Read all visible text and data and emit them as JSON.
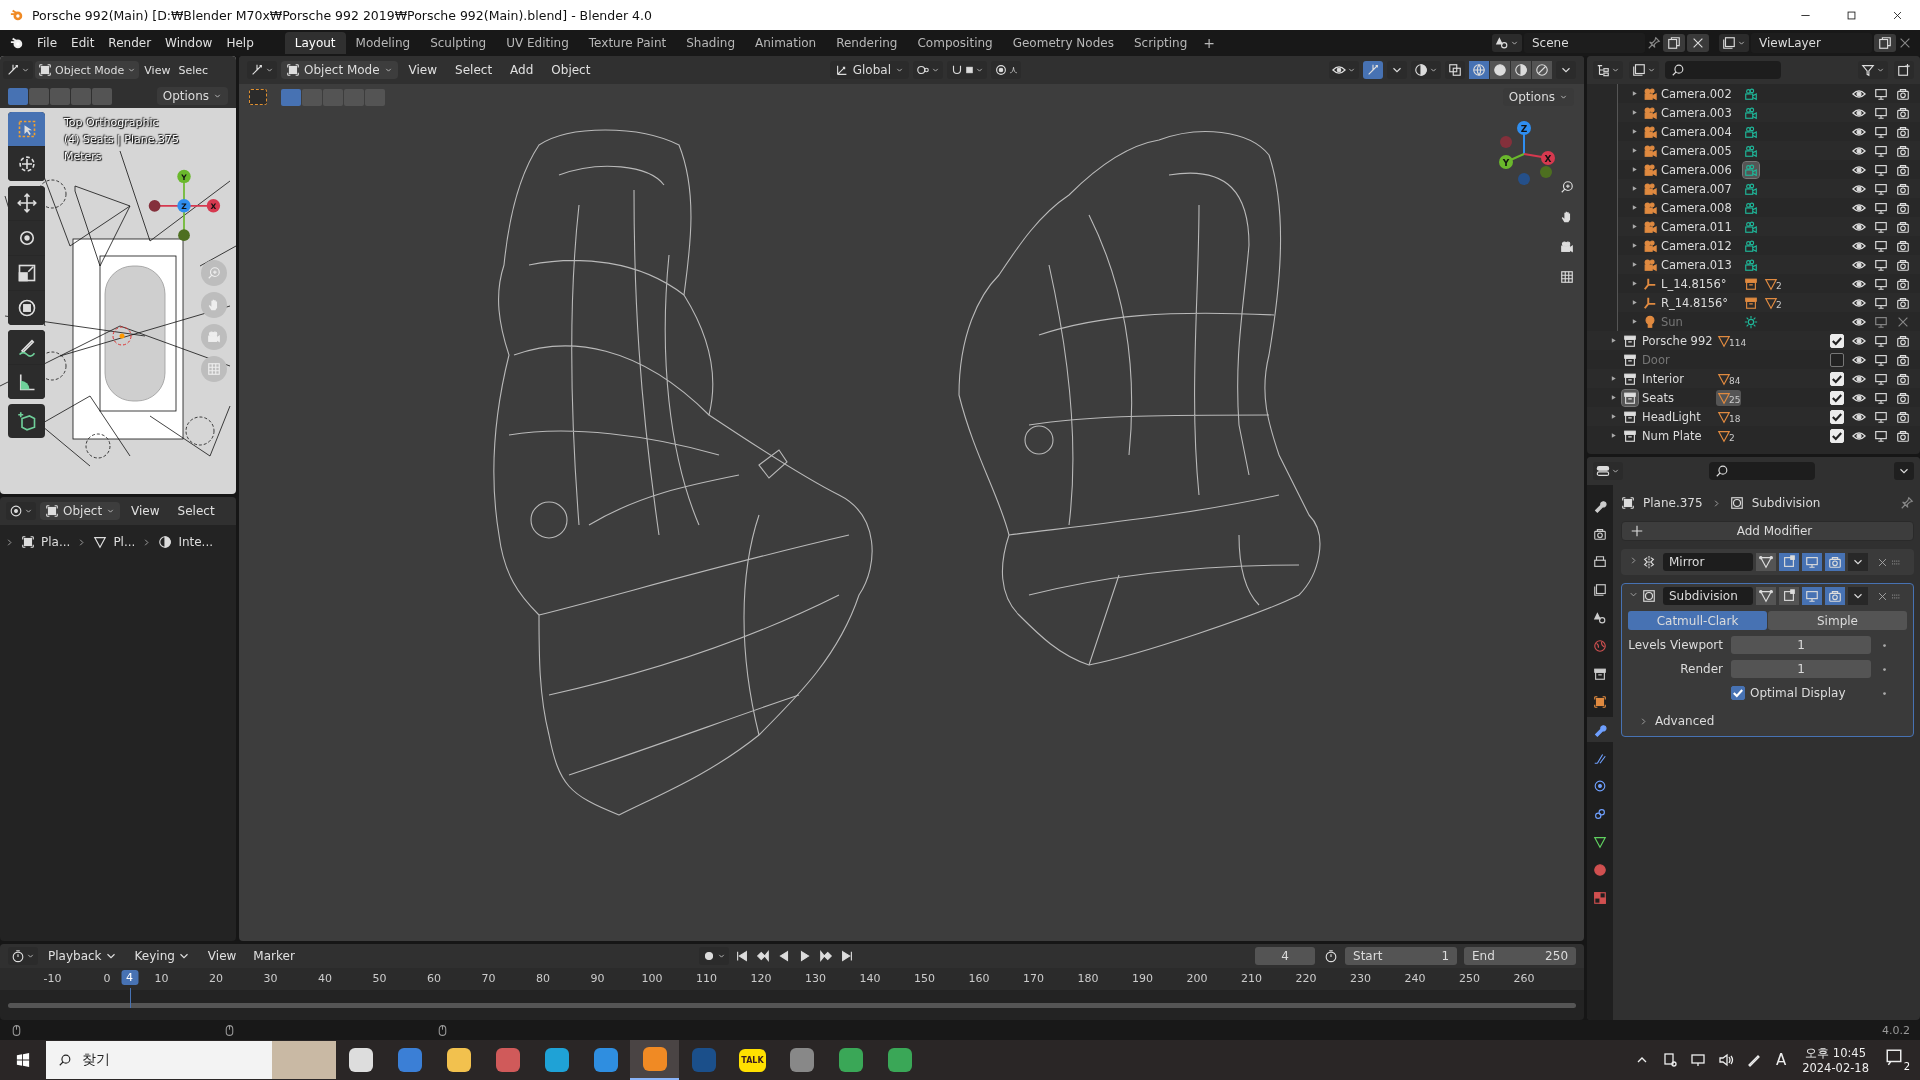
{
  "window": {
    "title": "Porsche 992(Main) [D:₩Blender M70x₩Porsche 992 2019₩Porsche 992(Main).blend] - Blender 4.0"
  },
  "menus": [
    "File",
    "Edit",
    "Render",
    "Window",
    "Help"
  ],
  "workspaces": [
    {
      "label": "Layout",
      "selected": true
    },
    {
      "label": "Modeling",
      "selected": false
    },
    {
      "label": "Sculpting",
      "selected": false
    },
    {
      "label": "UV Editing",
      "selected": false
    },
    {
      "label": "Texture Paint",
      "selected": false
    },
    {
      "label": "Shading",
      "selected": false
    },
    {
      "label": "Animation",
      "selected": false
    },
    {
      "label": "Rendering",
      "selected": false
    },
    {
      "label": "Compositing",
      "selected": false
    },
    {
      "label": "Geometry Nodes",
      "selected": false
    },
    {
      "label": "Scripting",
      "selected": false
    }
  ],
  "add_workspace": "+",
  "scene": "Scene",
  "view_layer": "ViewLayer",
  "mini_viewport": {
    "mode": "Object Mode",
    "menus": [
      "View",
      "Selec"
    ],
    "options": "Options",
    "overlay": [
      "Top Orthographic",
      "(4) Seats | Plane.375",
      "Meters"
    ],
    "axes": [
      "Y",
      "Z",
      "X"
    ]
  },
  "lower_editor": {
    "mode": "Object",
    "menus": [
      "View",
      "Select"
    ],
    "path": [
      "Pla...",
      "Pl...",
      "Inte..."
    ]
  },
  "viewport": {
    "mode": "Object Mode",
    "menus": [
      "View",
      "Select",
      "Add",
      "Object"
    ],
    "orientation": "Global",
    "options": "Options",
    "axes": [
      "Z",
      "Y",
      "X"
    ]
  },
  "outliner": {
    "objects": [
      {
        "name": "Camera.002",
        "kind": "camera",
        "active": false,
        "disabled": false
      },
      {
        "name": "Camera.003",
        "kind": "camera",
        "active": false,
        "disabled": false
      },
      {
        "name": "Camera.004",
        "kind": "camera",
        "active": false,
        "disabled": false
      },
      {
        "name": "Camera.005",
        "kind": "camera",
        "active": false,
        "disabled": false
      },
      {
        "name": "Camera.006",
        "kind": "camera",
        "active": true,
        "disabled": false
      },
      {
        "name": "Camera.007",
        "kind": "camera",
        "active": false,
        "disabled": false
      },
      {
        "name": "Camera.008",
        "kind": "camera",
        "active": false,
        "disabled": false
      },
      {
        "name": "Camera.011",
        "kind": "camera",
        "active": false,
        "disabled": false
      },
      {
        "name": "Camera.012",
        "kind": "camera",
        "active": false,
        "disabled": false
      },
      {
        "name": "Camera.013",
        "kind": "camera",
        "active": false,
        "disabled": false
      },
      {
        "name": "L_14.8156°",
        "kind": "empty",
        "badge": "2",
        "active": false,
        "disabled": false
      },
      {
        "name": "R_14.8156°",
        "kind": "empty",
        "badge": "2",
        "active": false,
        "disabled": false
      },
      {
        "name": "Sun",
        "kind": "light",
        "active": false,
        "disabled": true
      }
    ],
    "collections": [
      {
        "name": "Porsche 992",
        "checked": true,
        "badge": "114",
        "active": false
      },
      {
        "name": "Door",
        "checked": false,
        "active": false
      },
      {
        "name": "Interior",
        "checked": true,
        "badge": "84",
        "active": false
      },
      {
        "name": "Seats",
        "checked": true,
        "badge": "25",
        "active": true
      },
      {
        "name": "HeadLight",
        "checked": true,
        "badge": "18",
        "active": false
      },
      {
        "name": "Num Plate",
        "checked": true,
        "badge": "2",
        "active": false
      }
    ]
  },
  "properties": {
    "object": "Plane.375",
    "modifier": "Subdivision",
    "add_modifier": "Add Modifier",
    "tabs": [
      {
        "kind": "tool",
        "selected": false
      },
      {
        "kind": "render",
        "selected": false
      },
      {
        "kind": "output",
        "selected": false
      },
      {
        "kind": "view-layer",
        "selected": false
      },
      {
        "kind": "scene",
        "selected": false
      },
      {
        "kind": "world",
        "selected": false
      },
      {
        "kind": "collection",
        "selected": false
      },
      {
        "kind": "object",
        "selected": false
      },
      {
        "kind": "modifier",
        "selected": true
      },
      {
        "kind": "particles",
        "selected": false
      },
      {
        "kind": "physics",
        "selected": false
      },
      {
        "kind": "constraints",
        "selected": false
      },
      {
        "kind": "data",
        "selected": false
      },
      {
        "kind": "material",
        "selected": false
      },
      {
        "kind": "texture",
        "selected": false
      }
    ],
    "modifiers": [
      {
        "name": "Mirror",
        "kind": "mirror",
        "expanded": false,
        "toggles": [
          false,
          true,
          true,
          true
        ]
      },
      {
        "name": "Subdivision",
        "kind": "subdivision",
        "expanded": true,
        "toggles": [
          false,
          false,
          true,
          true
        ]
      }
    ],
    "types": [
      {
        "label": "Catmull-Clark",
        "selected": true
      },
      {
        "label": "Simple",
        "selected": false
      }
    ],
    "fields": [
      {
        "label": "Levels Viewport",
        "value": "1"
      },
      {
        "label": "Render",
        "value": "1"
      }
    ],
    "optimal_display": {
      "label": "Optimal Display",
      "checked": true
    },
    "advanced": "Advanced"
  },
  "timeline": {
    "menus": [
      "Playback",
      "Keying",
      "View",
      "Marker"
    ],
    "frame": "4",
    "start_label": "Start",
    "start": "1",
    "end_label": "End",
    "end": "250",
    "current": "4",
    "ticks": [
      "-10",
      "0",
      "10",
      "20",
      "30",
      "40",
      "50",
      "60",
      "70",
      "80",
      "90",
      "100",
      "110",
      "120",
      "130",
      "140",
      "150",
      "160",
      "170",
      "180",
      "190",
      "200",
      "210",
      "220",
      "230",
      "240",
      "250",
      "260"
    ]
  },
  "status": {
    "version": "4.0.2"
  },
  "taskbar": {
    "search": "찾기",
    "apps": [
      {
        "kind": "task-view",
        "active": false
      },
      {
        "kind": "calculator",
        "active": false
      },
      {
        "kind": "folder",
        "active": false
      },
      {
        "kind": "app",
        "active": false
      },
      {
        "kind": "edge",
        "active": false
      },
      {
        "kind": "ie",
        "active": false
      },
      {
        "kind": "blender",
        "active": true
      },
      {
        "kind": "steam",
        "active": false
      },
      {
        "kind": "chat",
        "active": false,
        "label": "TALK"
      },
      {
        "kind": "cloud",
        "active": false
      },
      {
        "kind": "chrome",
        "active": false
      },
      {
        "kind": "chrome",
        "active": false
      }
    ],
    "ime": "A",
    "time": "오후 10:45",
    "date": "2024-02-18",
    "notifications": "2"
  }
}
